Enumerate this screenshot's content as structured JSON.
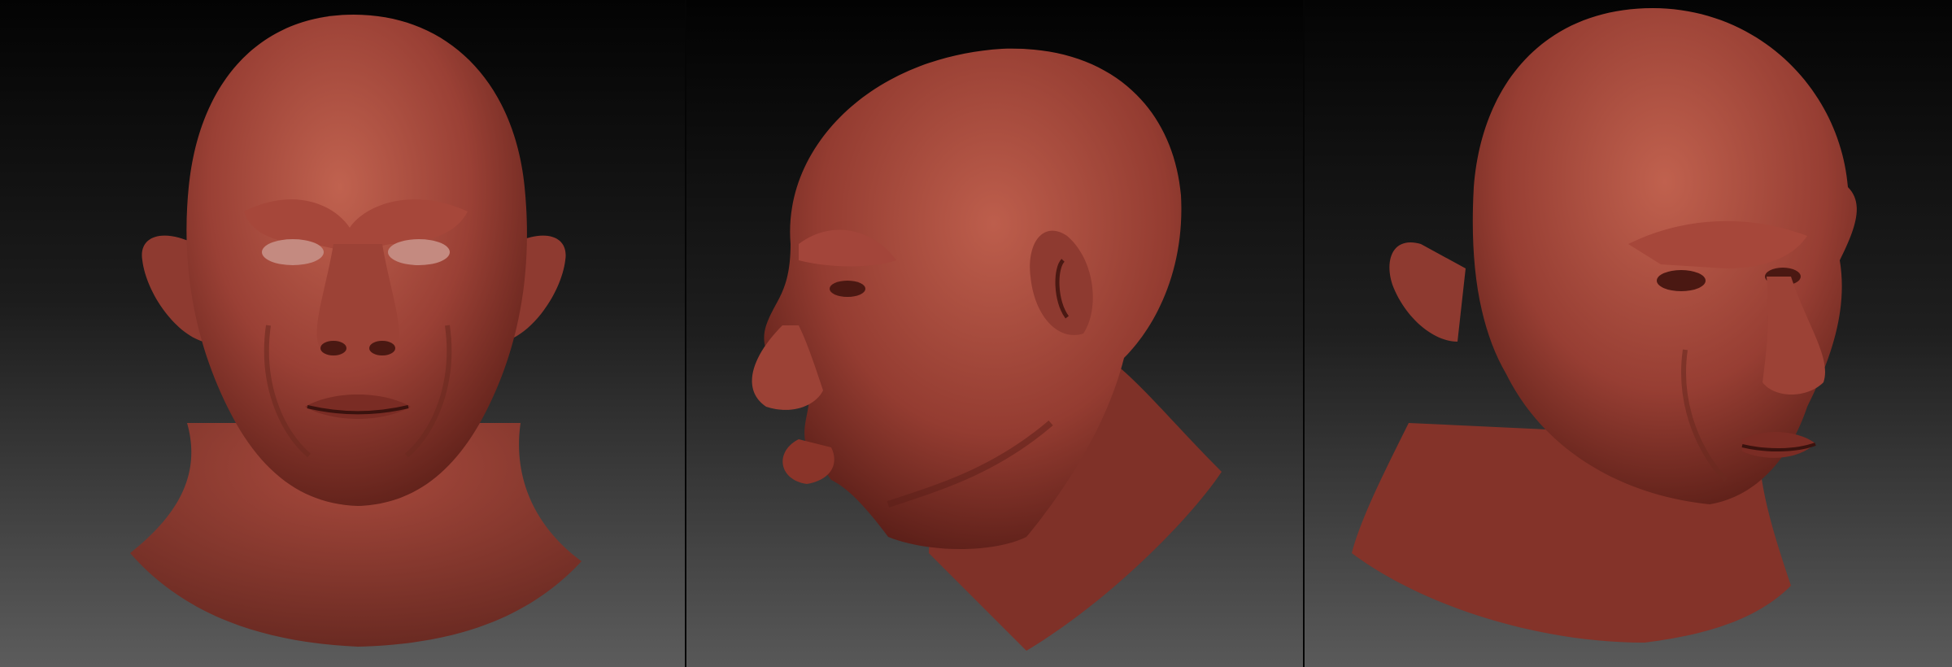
{
  "scene": {
    "background_top": "#050505",
    "background_bottom": "#5a5a5a",
    "skin_light": "#b8574a",
    "skin_mid": "#8f3a30",
    "skin_dark": "#4a1812",
    "views": [
      {
        "name": "front-view"
      },
      {
        "name": "side-view"
      },
      {
        "name": "three-quarter-view"
      }
    ]
  }
}
